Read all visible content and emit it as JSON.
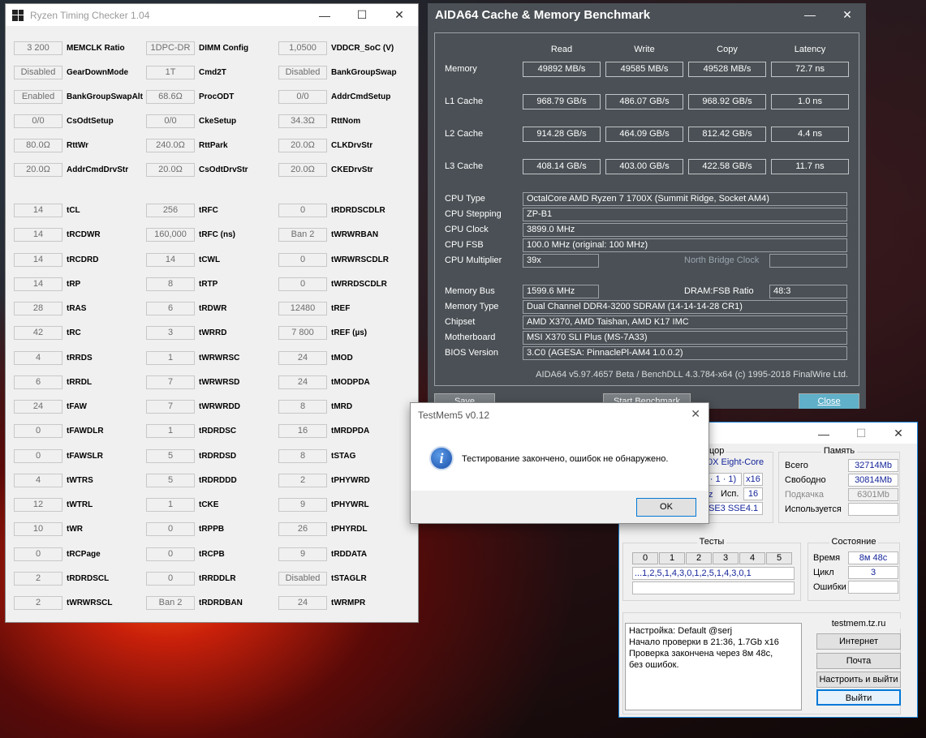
{
  "ryzen": {
    "title": "Ryzen Timing Checker 1.04",
    "cells": [
      [
        "3 200",
        "MEMCLK Ratio",
        "1DPC-DR",
        "DIMM Config",
        "1,0500",
        "VDDCR_SoC (V)"
      ],
      [
        "Disabled",
        "GearDownMode",
        "1T",
        "Cmd2T",
        "Disabled",
        "BankGroupSwap"
      ],
      [
        "Enabled",
        "BankGroupSwapAlt",
        "68.6Ω",
        "ProcODT",
        "0/0",
        "AddrCmdSetup"
      ],
      [
        "0/0",
        "CsOdtSetup",
        "0/0",
        "CkeSetup",
        "34.3Ω",
        "RttNom"
      ],
      [
        "80.0Ω",
        "RttWr",
        "240.0Ω",
        "RttPark",
        "20.0Ω",
        "CLKDrvStr"
      ],
      [
        "20.0Ω",
        "AddrCmdDrvStr",
        "20.0Ω",
        "CsOdtDrvStr",
        "20.0Ω",
        "CKEDrvStr"
      ]
    ],
    "timings": [
      [
        "14",
        "tCL",
        "256",
        "tRFC",
        "0",
        "tRDRDSCDLR"
      ],
      [
        "14",
        "tRCDWR",
        "160,000",
        "tRFC (ns)",
        "Ban 2",
        "tWRWRBAN"
      ],
      [
        "14",
        "tRCDRD",
        "14",
        "tCWL",
        "0",
        "tWRWRSCDLR"
      ],
      [
        "14",
        "tRP",
        "8",
        "tRTP",
        "0",
        "tWRRDSCDLR"
      ],
      [
        "28",
        "tRAS",
        "6",
        "tRDWR",
        "12480",
        "tREF"
      ],
      [
        "42",
        "tRC",
        "3",
        "tWRRD",
        "7 800",
        "tREF (µs)"
      ],
      [
        "4",
        "tRRDS",
        "1",
        "tWRWRSC",
        "24",
        "tMOD"
      ],
      [
        "6",
        "tRRDL",
        "7",
        "tWRWRSD",
        "24",
        "tMODPDA"
      ],
      [
        "24",
        "tFAW",
        "7",
        "tWRWRDD",
        "8",
        "tMRD"
      ],
      [
        "0",
        "tFAWDLR",
        "1",
        "tRDRDSC",
        "16",
        "tMRDPDA"
      ],
      [
        "0",
        "tFAWSLR",
        "5",
        "tRDRDSD",
        "8",
        "tSTAG"
      ],
      [
        "4",
        "tWTRS",
        "5",
        "tRDRDDD",
        "2",
        "tPHYWRD"
      ],
      [
        "12",
        "tWTRL",
        "1",
        "tCKE",
        "9",
        "tPHYWRL"
      ],
      [
        "10",
        "tWR",
        "0",
        "tRPPB",
        "26",
        "tPHYRDL"
      ],
      [
        "0",
        "tRCPage",
        "0",
        "tRCPB",
        "9",
        "tRDDATA"
      ],
      [
        "2",
        "tRDRDSCL",
        "0",
        "tRRDDLR",
        "Disabled",
        "tSTAGLR"
      ],
      [
        "2",
        "tWRWRSCL",
        "Ban 2",
        "tRDRDBAN",
        "24",
        "tWRMPR"
      ]
    ]
  },
  "aida": {
    "title": "AIDA64 Cache & Memory Benchmark",
    "headers": [
      "Read",
      "Write",
      "Copy",
      "Latency"
    ],
    "rows": [
      {
        "label": "Memory",
        "vals": [
          "49892 MB/s",
          "49585 MB/s",
          "49528 MB/s",
          "72.7 ns"
        ]
      },
      {
        "label": "L1 Cache",
        "vals": [
          "968.79 GB/s",
          "486.07 GB/s",
          "968.92 GB/s",
          "1.0 ns"
        ]
      },
      {
        "label": "L2 Cache",
        "vals": [
          "914.28 GB/s",
          "464.09 GB/s",
          "812.42 GB/s",
          "4.4 ns"
        ]
      },
      {
        "label": "L3 Cache",
        "vals": [
          "408.14 GB/s",
          "403.00 GB/s",
          "422.58 GB/s",
          "11.7 ns"
        ]
      }
    ],
    "info": [
      {
        "label": "CPU Type",
        "value": "OctalCore AMD Ryzen 7 1700X  (Summit Ridge, Socket AM4)"
      },
      {
        "label": "CPU Stepping",
        "value": "ZP-B1"
      },
      {
        "label": "CPU Clock",
        "value": "3899.0 MHz"
      },
      {
        "label": "CPU FSB",
        "value": "100.0 MHz  (original: 100 MHz)"
      },
      {
        "label": "CPU Multiplier",
        "value": "39x"
      },
      {
        "label": "Memory Bus",
        "value": "1599.6 MHz"
      },
      {
        "label": "Memory Type",
        "value": "Dual Channel DDR4-3200 SDRAM  (14-14-14-28 CR1)"
      },
      {
        "label": "Chipset",
        "value": "AMD X370, AMD Taishan, AMD K17 IMC"
      },
      {
        "label": "Motherboard",
        "value": "MSI X370 SLI Plus (MS-7A33)"
      },
      {
        "label": "BIOS Version",
        "value": "3.C0  (AGESA: PinnaclePl-AM4 1.0.0.2)"
      }
    ],
    "nb_label": "North Bridge Clock",
    "ratio_label": "DRAM:FSB Ratio",
    "ratio_value": "48:3",
    "footer": "AIDA64 v5.97.4657 Beta / BenchDLL 4.3.784-x64  (c) 1995-2018 FinalWire Ltd.",
    "save": "Save",
    "start": "Start Benchmark",
    "close": "Close"
  },
  "testmem": {
    "cpu_title": "цор",
    "cpu_name": "0X Eight-Core",
    "cpu_l1": "· 1 · 1)",
    "cpu_x": "x16",
    "cpu_z": "z",
    "isp_label": "Исп.",
    "isp_val": "16",
    "cpu_flags": "SE3 SSE4.1",
    "mem_title": "Память",
    "total_label": "Всего",
    "total": "32714Mb",
    "free_label": "Свободно",
    "free": "30814Mb",
    "swap_label": "Подкачка",
    "swap": "6301Mb",
    "used_label": "Используется",
    "tests_title": "Тесты",
    "tests": [
      "0",
      "1",
      "2",
      "3",
      "4",
      "5"
    ],
    "seq": "...1,2,5,1,4,3,0,1,2,5,1,4,3,0,1",
    "state_title": "Состояние",
    "time_label": "Время",
    "time": "8м 48с",
    "cycle_label": "Цикл",
    "cycle": "3",
    "err_label": "Ошибки",
    "log": [
      "Настройка: Default @serj",
      "Начало проверки в 21:36, 1.7Gb x16",
      "Проверка закончена через 8м 48с,",
      "без ошибок."
    ],
    "site": "testmem.tz.ru",
    "btn_internet": "Интернет",
    "btn_mail": "Почта",
    "btn_setup": "Настроить и выйти",
    "btn_exit": "Выйти"
  },
  "dialog": {
    "title": "TestMem5 v0.12",
    "message": "Тестирование закончено, ошибок не обнаружено.",
    "ok": "OK"
  }
}
